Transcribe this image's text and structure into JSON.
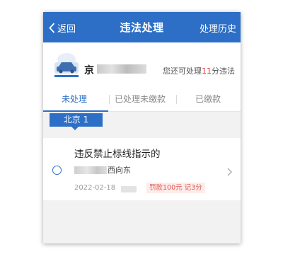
{
  "header": {
    "back_label": "返回",
    "title": "违法处理",
    "history_label": "处理历史"
  },
  "car": {
    "plate_prefix": "京",
    "remain_prefix": "您还可处理",
    "remain_points": "11",
    "remain_suffix": "分违法"
  },
  "tabs": [
    {
      "label": "未处理"
    },
    {
      "label": "已处理未缴款"
    },
    {
      "label": "已缴款"
    }
  ],
  "city_tag": "北京 1",
  "violations": [
    {
      "title": "违反禁止标线指示的",
      "location_suffix": "西向东",
      "date": "2022-02-18",
      "penalty": "罚款100元 记3分"
    }
  ],
  "colors": {
    "primary": "#2d6fc6",
    "accent_red": "#e33333",
    "penalty_bg": "#fdeceb",
    "page_bg": "#f2f2f2"
  }
}
